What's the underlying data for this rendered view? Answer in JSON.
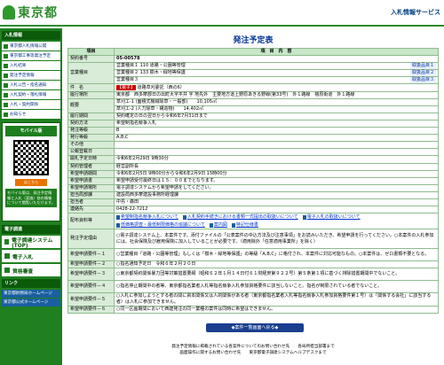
{
  "header": {
    "logo": "東京都",
    "right_link": "入札情報サービス"
  },
  "sidebar": {
    "section1": "入札情報",
    "items": [
      "東京都入札情報公開",
      "東京都工事等発注予定",
      "入札結果",
      "発注予定情報",
      "入札公告・指名通知",
      "入札契約・落札情報",
      "入札・契約関係",
      "お知らせ"
    ],
    "mobile_title": "モバイル版",
    "qr_link": "はこちら",
    "mobile_note": "モバイル版は、発注予定情報と入札（実施）前の情報について閲覧いただけます。",
    "section2": "電子調達",
    "big_buttons": [
      "電子調達システム(TOP)",
      "電子入札",
      "資格審査"
    ],
    "section3": "リンク",
    "links": [
      "東京都財務局ホームページ",
      "東京都公式ホームページ"
    ]
  },
  "main": {
    "title": "発注予定表",
    "col_item": "項目",
    "col_content": "項　目　内　容",
    "rows": {
      "keiyaku_no": {
        "k": "契約番号",
        "v": "05-00578"
      },
      "eigyo1": {
        "k": "営業種目",
        "v": "営業種目１ 110 道路・公園等管理",
        "tag": "取扱品目１"
      },
      "eigyo2": {
        "v": "営業種目２ 133 樹木・緑地等保護",
        "tag": "取扱品目２"
      },
      "eigyo3": {
        "v": "営業種目３",
        "tag": "取扱品目３"
      },
      "kenmei": {
        "k": "件　名",
        "tag": "【電子】",
        "v": "道路草刈委託（西の6）"
      },
      "basho": {
        "k": "履行場所",
        "v": "東京都　西多摩郡日の出町大字平井 字 地先外　主要地方道上野原あきる野線(第33号)　外１路線　檜原街道　外１路線"
      },
      "gaiyo1": {
        "k": "概要",
        "v": "草刈工-1 (面積式機械除草・一般部)",
        "v2": "10,105㎡"
      },
      "gaiyo2": {
        "v": "草刈工-2 (人力除草・構造物)",
        "v2": "14,402㎡"
      },
      "kikan": {
        "k": "履行期間",
        "v": "契約確定の日の翌日から令和6年7月31日まで"
      },
      "hoho": {
        "k": "契約方法",
        "v": "希望制指名競争入札"
      },
      "kubun": {
        "k": "発注等級",
        "v": "B"
      },
      "tokkyu": {
        "k": "発行等級",
        "v": "A,B,C"
      },
      "other": {
        "k": "その他"
      },
      "koukoku": {
        "k": "公報登載日"
      },
      "kaisatsu": {
        "k": "開札予定日時",
        "v": "令和6年2月29日 9時30分"
      },
      "kessai": {
        "k": "契約管理者",
        "v": "経営副所長"
      },
      "shinsei": {
        "k": "希望申請期間",
        "v": "令和6年2月5日 9時00分から令和6年2月9日 15時00分"
      },
      "shinsei_sho": {
        "k": "希望申請書",
        "v": "希望申請受付最終日は１５：００までとなります。"
      },
      "shinsei_basho": {
        "k": "希望申請場所",
        "v": "電子調達システムから希望申請をしてください。"
      },
      "tanto": {
        "k": "担当局部課",
        "v": "建設局西多摩建設事務所経理課"
      },
      "tantosha": {
        "k": "担当者",
        "v": "中島・森田"
      },
      "renraku": {
        "k": "連絡先",
        "v": "0428-22-7212"
      },
      "haifu": {
        "k": "配布資料等",
        "attachments": [
          "希望制指名競争入札について",
          "入札契約手続きにおける書類一式提出の取扱いについて",
          "電子入札の取扱いについて",
          "低価格調査・最低制限価格の協議について",
          "案内図",
          "特記仕様書"
        ]
      },
      "yotei": {
        "k": "発注予定理由",
        "v": "○電子調達システム上、本案件です。添付ファイルの「公表案件の中込方法及び注意事項」をお読みいただき、希望申請を行ってください。○本案件の入札参加には、社会保険及び雇用保険に加入していることが必要です。（適用除外「任意適用事業所」を除く）"
      },
      "joken1": {
        "k": "希望申請要件－１",
        "v": "○営業種目「道路・公園等管理」もしくは「樹木・緑地等保護」の等級「A,B,C」に格付され、本案件に対応可能なもの。○本案件は、ゼロ書類不要となる。"
      },
      "joken2": {
        "k": "希望申請要件－２",
        "v": "○指名通知予定日　令和６年２月２０日"
      },
      "joken3": {
        "k": "希望申請要件－３",
        "v": "○東京都契約関係暴力団等対策措置要綱（昭和６２年１月１４日付６１財経庶第９２２号）第５条第１項に基づく排除措置期間中でないこと。"
      },
      "joken4": {
        "k": "希望申請要件－４",
        "v": "○指名停止期間中の者等、東京都指名業者入札等指名競争入札参加資格要件に該当しないこと。指名が制限されている者でないこと。"
      },
      "joken5": {
        "k": "希望申請要件－５",
        "v": "○入札に参加しようとする者の間に資本関係又は人的関係がある者（東京都指名業者入札等指名競争入札参加資格要件第１号）は「関係する会社」に該当する者）は入札に参加できません。"
      },
      "joken6": {
        "k": "希望申請要件－６",
        "v": "○同一区画期間において西建発注の同一業種の案件は同時に希望はできません。"
      }
    },
    "back_button": "◆案件一覧画面へ戻る◆",
    "footer_line1": "発注予定情報に掲載されている各案件についてのお問い合わせ先　　各局所担当部署まで",
    "footer_line2": "画面操作に関するお問い合わせ先　　東京都電子調達システムヘルプデスクまで"
  }
}
